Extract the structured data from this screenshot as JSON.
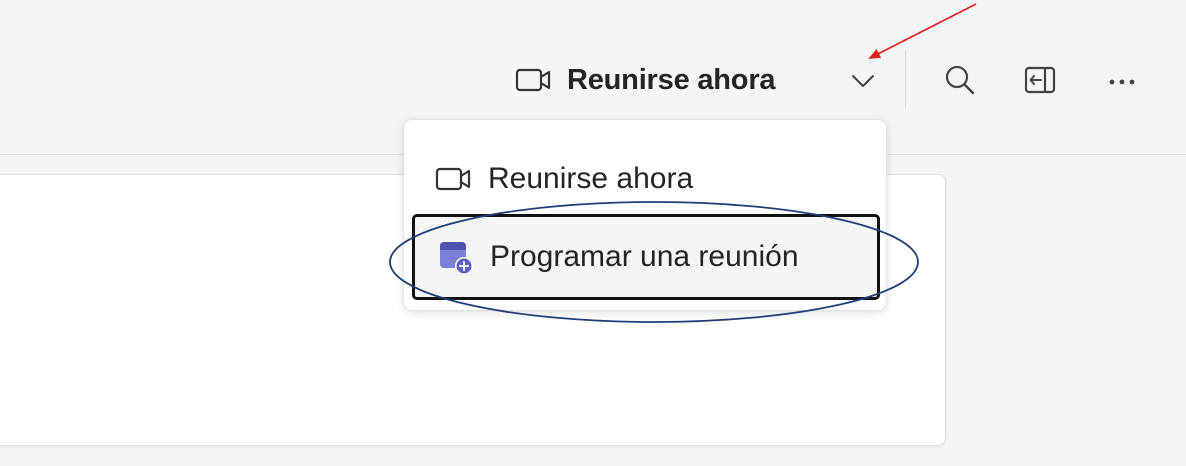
{
  "header": {
    "meet_now_label": "Reunirse ahora",
    "icons": {
      "meet": "video-camera-icon",
      "chevron": "chevron-down-icon",
      "search": "search-icon",
      "panel": "side-panel-icon",
      "more": "more-options-icon"
    }
  },
  "menu": {
    "items": [
      {
        "label": "Reunirse ahora",
        "icon": "video-camera-icon",
        "selected": false
      },
      {
        "label": "Programar una reunión",
        "icon": "calendar-add-icon",
        "selected": true
      }
    ]
  },
  "colors": {
    "accent": "#5b5fc7",
    "annotation_arrow": "#e0201b",
    "annotation_ellipse": "#1f3f7a"
  }
}
